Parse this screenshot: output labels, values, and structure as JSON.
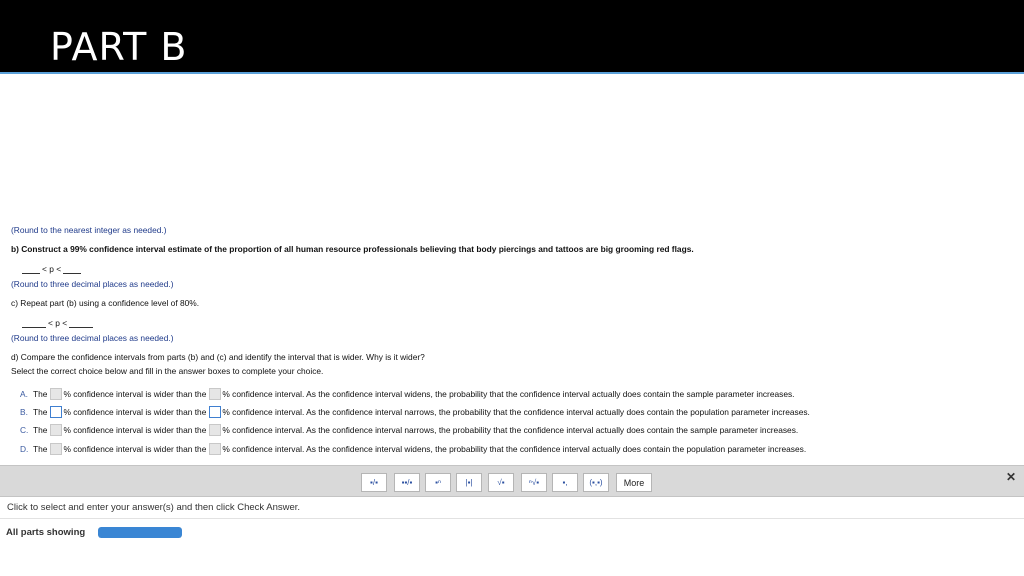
{
  "header": {
    "title": "PART B"
  },
  "questions": {
    "a_note": "(Round to the nearest integer as needed.)",
    "b_prompt": "b) Construct a 99% confidence interval estimate of the proportion of all human resource professionals believing that body piercings and tattoos are big grooming red flags.",
    "b_ineq_mid": "< p <",
    "b_note": "(Round to three decimal places as needed.)",
    "c_prompt": "c) Repeat part (b) using a confidence level of 80%.",
    "c_ineq_mid": "< p <",
    "c_note": "(Round to three decimal places as needed.)",
    "d_prompt": "d) Compare the confidence intervals from parts (b) and (c) and identify the interval that is wider. Why is it wider?",
    "d_instruction": "Select the correct choice below and fill in the answer boxes to complete your choice."
  },
  "choices": [
    {
      "letter": "A.",
      "the": "The",
      "mid": "% confidence interval is wider than the",
      "tail": "% confidence interval. As the confidence interval widens, the probability that the confidence interval actually does contain the sample parameter increases."
    },
    {
      "letter": "B.",
      "the": "The",
      "mid": "% confidence interval is wider than the",
      "tail": "% confidence interval. As the confidence interval narrows, the probability that the confidence interval actually does contain the population parameter increases."
    },
    {
      "letter": "C.",
      "the": "The",
      "mid": "% confidence interval is wider than the",
      "tail": "% confidence interval. As the confidence interval narrows, the probability that the confidence interval actually does contain the sample parameter increases."
    },
    {
      "letter": "D.",
      "the": "The",
      "mid": "% confidence interval is wider than the",
      "tail": "% confidence interval. As the confidence interval widens, the probability that the confidence interval actually does contain the population parameter increases."
    }
  ],
  "toolbar": {
    "buttons": [
      "fraction-icon",
      "mixed-number-icon",
      "exponent-icon",
      "absolute-value-icon",
      "sqrt-icon",
      "nth-root-icon",
      "subscript-icon",
      "interval-icon"
    ],
    "glyphs": [
      "▪/▪",
      "▪▪/▪",
      "▪ⁿ",
      "|▪|",
      "√▪",
      "ⁿ√▪",
      "▪,",
      "(▪,▪)"
    ],
    "more_label": "More",
    "close": "✕"
  },
  "footer": {
    "instruction": "Click to select and enter your answer(s) and then click Check Answer.",
    "all_parts": "All parts showing",
    "progress": 1.0
  }
}
